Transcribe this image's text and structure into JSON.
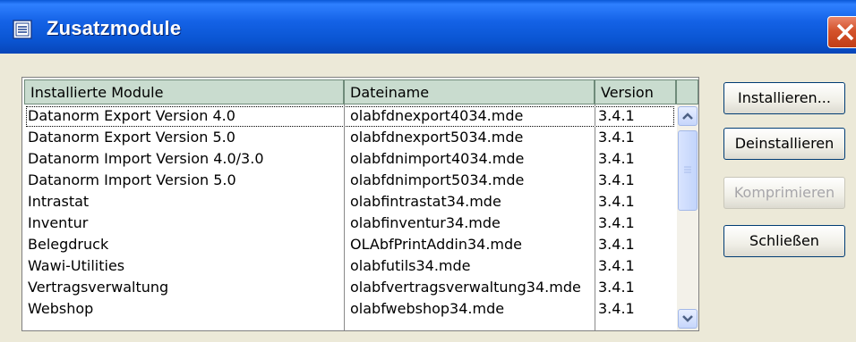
{
  "window": {
    "title": "Zusatzmodule",
    "accent": "#0a55d2",
    "system_icon": "window-icon",
    "close_icon": "close-icon"
  },
  "list": {
    "columns": [
      "Installierte Module",
      "Dateiname",
      "Version"
    ],
    "rows": [
      {
        "module": "Datanorm Export Version 4.0",
        "file": "olabfdnexport4034.mde",
        "version": "3.4.1"
      },
      {
        "module": "Datanorm Export Version 5.0",
        "file": "olabfdnexport5034.mde",
        "version": "3.4.1"
      },
      {
        "module": "Datanorm Import Version 4.0/3.0",
        "file": "olabfdnimport4034.mde",
        "version": "3.4.1"
      },
      {
        "module": "Datanorm Import Version 5.0",
        "file": "olabfdnimport5034.mde",
        "version": "3.4.1"
      },
      {
        "module": "Intrastat",
        "file": "olabfintrastat34.mde",
        "version": "3.4.1"
      },
      {
        "module": "Inventur",
        "file": "olabfinventur34.mde",
        "version": "3.4.1"
      },
      {
        "module": "Belegdruck",
        "file": "OLAbfPrintAddin34.mde",
        "version": "3.4.1"
      },
      {
        "module": "Wawi-Utilities",
        "file": "olabfutils34.mde",
        "version": "3.4.1"
      },
      {
        "module": "Vertragsverwaltung",
        "file": "olabfvertragsverwaltung34.mde",
        "version": "3.4.1"
      },
      {
        "module": "Webshop",
        "file": "olabfwebshop34.mde",
        "version": "3.4.1"
      }
    ],
    "header_color": "#c9dccf"
  },
  "buttons": {
    "install": "Installieren...",
    "uninstall": "Deinstallieren",
    "compress": "Komprimieren",
    "close": "Schließen"
  }
}
